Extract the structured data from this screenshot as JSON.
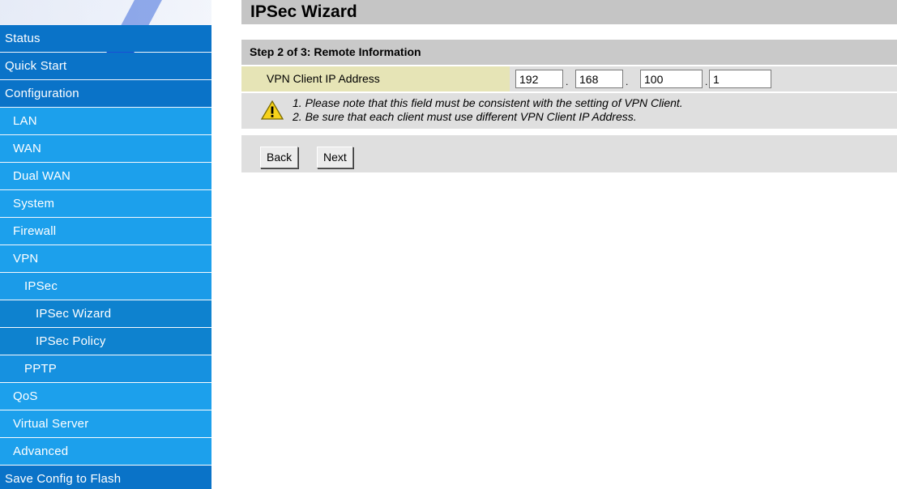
{
  "sidebar": {
    "items": [
      {
        "label": "Status",
        "level": 0
      },
      {
        "label": "Quick Start",
        "level": 0
      },
      {
        "label": "Configuration",
        "level": 0
      },
      {
        "label": "LAN",
        "level": 1
      },
      {
        "label": "WAN",
        "level": 1
      },
      {
        "label": "Dual WAN",
        "level": 1
      },
      {
        "label": "System",
        "level": 1
      },
      {
        "label": "Firewall",
        "level": 1
      },
      {
        "label": "VPN",
        "level": 1
      },
      {
        "label": "IPSec",
        "level": 2
      },
      {
        "label": "IPSec Wizard",
        "level": 3
      },
      {
        "label": "IPSec Policy",
        "level": 3
      },
      {
        "label": "PPTP",
        "level": 2
      },
      {
        "label": "QoS",
        "level": 1
      },
      {
        "label": "Virtual Server",
        "level": 1
      },
      {
        "label": "Advanced",
        "level": 1
      },
      {
        "label": "Save Config to Flash",
        "level": 0
      }
    ]
  },
  "page": {
    "title": "IPSec Wizard",
    "step": "Step 2 of 3: Remote Information"
  },
  "form": {
    "field_label": "VPN Client IP Address",
    "ip": [
      "192",
      "168",
      "100",
      "1"
    ],
    "notes": [
      "1. Please note that this field must be consistent with the setting of VPN Client.",
      "2. Be sure that each client must use different VPN Client IP Address."
    ],
    "warning_icon": "warning-icon"
  },
  "actions": {
    "back_label": "Back",
    "next_label": "Next"
  },
  "colors": {
    "menu_top_level": "#0a73c8",
    "menu_sub_level": "#1ca0ec",
    "field_label_bg": "#e6e4b6",
    "panel_bg": "#dfdfdf"
  }
}
